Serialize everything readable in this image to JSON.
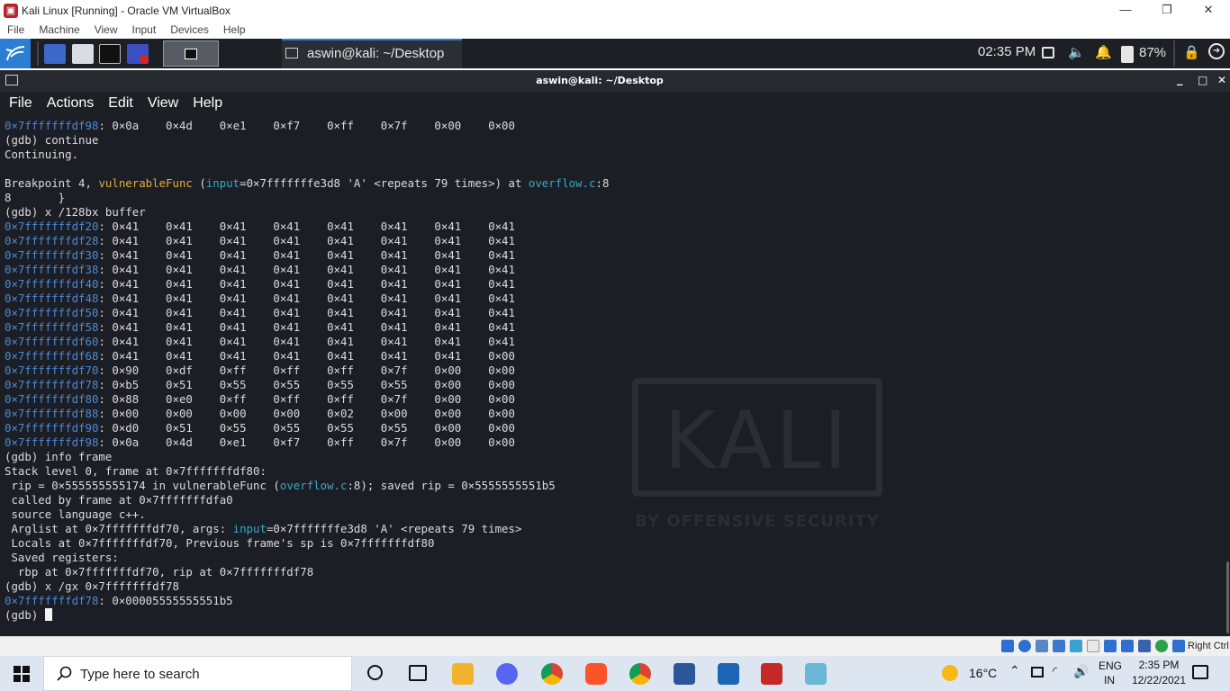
{
  "vbox": {
    "title": "Kali Linux [Running] - Oracle VM VirtualBox",
    "app_icon": "virtualbox-icon",
    "controls": {
      "minimize": "—",
      "restore": "❐",
      "close": "✕"
    },
    "menu": [
      "File",
      "Machine",
      "View",
      "Input",
      "Devices",
      "Help"
    ],
    "status_host_key": "Right Ctrl"
  },
  "panel": {
    "window_title": "aswin@kali: ~/Desktop",
    "clock": "02:35 PM",
    "battery": "87%"
  },
  "terminal": {
    "title": "aswin@kali: ~/Desktop",
    "controls": {
      "minimize": "_",
      "maximize": "□",
      "close": "✕"
    },
    "menu": [
      "File",
      "Actions",
      "Edit",
      "View",
      "Help"
    ],
    "lines": [
      {
        "addr": "0×7fffffffdf98",
        "text": ": 0×0a    0×4d    0×e1    0×f7    0×ff    0×7f    0×00    0×00"
      },
      {
        "text": "(gdb) continue"
      },
      {
        "text": "Continuing."
      },
      {
        "text": ""
      },
      {
        "parts": [
          {
            "t": "Breakpoint 4, "
          },
          {
            "t": "vulnerableFunc",
            "c": "f"
          },
          {
            "t": " ("
          },
          {
            "t": "input",
            "c": "c"
          },
          {
            "t": "=0×7fffffffe3d8 'A' <repeats 79 times>) at "
          },
          {
            "t": "overflow.c",
            "c": "c"
          },
          {
            "t": ":8"
          }
        ]
      },
      {
        "text": "8       }"
      },
      {
        "text": "(gdb) x /128bx buffer"
      },
      {
        "addr": "0×7fffffffdf20",
        "text": ": 0×41    0×41    0×41    0×41    0×41    0×41    0×41    0×41"
      },
      {
        "addr": "0×7fffffffdf28",
        "text": ": 0×41    0×41    0×41    0×41    0×41    0×41    0×41    0×41"
      },
      {
        "addr": "0×7fffffffdf30",
        "text": ": 0×41    0×41    0×41    0×41    0×41    0×41    0×41    0×41"
      },
      {
        "addr": "0×7fffffffdf38",
        "text": ": 0×41    0×41    0×41    0×41    0×41    0×41    0×41    0×41"
      },
      {
        "addr": "0×7fffffffdf40",
        "text": ": 0×41    0×41    0×41    0×41    0×41    0×41    0×41    0×41"
      },
      {
        "addr": "0×7fffffffdf48",
        "text": ": 0×41    0×41    0×41    0×41    0×41    0×41    0×41    0×41"
      },
      {
        "addr": "0×7fffffffdf50",
        "text": ": 0×41    0×41    0×41    0×41    0×41    0×41    0×41    0×41"
      },
      {
        "addr": "0×7fffffffdf58",
        "text": ": 0×41    0×41    0×41    0×41    0×41    0×41    0×41    0×41"
      },
      {
        "addr": "0×7fffffffdf60",
        "text": ": 0×41    0×41    0×41    0×41    0×41    0×41    0×41    0×41"
      },
      {
        "addr": "0×7fffffffdf68",
        "text": ": 0×41    0×41    0×41    0×41    0×41    0×41    0×41    0×00"
      },
      {
        "addr": "0×7fffffffdf70",
        "text": ": 0×90    0×df    0×ff    0×ff    0×ff    0×7f    0×00    0×00"
      },
      {
        "addr": "0×7fffffffdf78",
        "text": ": 0×b5    0×51    0×55    0×55    0×55    0×55    0×00    0×00"
      },
      {
        "addr": "0×7fffffffdf80",
        "text": ": 0×88    0×e0    0×ff    0×ff    0×ff    0×7f    0×00    0×00"
      },
      {
        "addr": "0×7fffffffdf88",
        "text": ": 0×00    0×00    0×00    0×00    0×02    0×00    0×00    0×00"
      },
      {
        "addr": "0×7fffffffdf90",
        "text": ": 0×d0    0×51    0×55    0×55    0×55    0×55    0×00    0×00"
      },
      {
        "addr": "0×7fffffffdf98",
        "text": ": 0×0a    0×4d    0×e1    0×f7    0×ff    0×7f    0×00    0×00"
      },
      {
        "text": "(gdb) info frame"
      },
      {
        "text": "Stack level 0, frame at 0×7fffffffdf80:"
      },
      {
        "parts": [
          {
            "t": " rip = 0×555555555174 in vulnerableFunc ("
          },
          {
            "t": "overflow.c",
            "c": "c"
          },
          {
            "t": ":8); saved rip = 0×5555555551b5"
          }
        ]
      },
      {
        "text": " called by frame at 0×7fffffffdfa0"
      },
      {
        "text": " source language c++."
      },
      {
        "parts": [
          {
            "t": " Arglist at 0×7fffffffdf70, args: "
          },
          {
            "t": "input",
            "c": "c"
          },
          {
            "t": "=0×7fffffffe3d8 'A' <repeats 79 times>"
          }
        ]
      },
      {
        "text": " Locals at 0×7fffffffdf70, Previous frame's sp is 0×7fffffffdf80"
      },
      {
        "text": " Saved registers:"
      },
      {
        "text": "  rbp at 0×7fffffffdf70, rip at 0×7fffffffdf78"
      },
      {
        "text": "(gdb) x /gx 0×7fffffffdf78"
      },
      {
        "addr": "0×7fffffffdf78",
        "text": ": 0×00005555555551b5"
      },
      {
        "prompt": "(gdb) "
      }
    ]
  },
  "watermark": {
    "word": "KALI",
    "tagline": "BY OFFENSIVE SECURITY"
  },
  "taskbar": {
    "search_placeholder": "Type here to search",
    "weather": "16°C",
    "lang_top": "ENG",
    "lang_bottom": "IN",
    "time": "2:35 PM",
    "date": "12/22/2021"
  },
  "colors": {
    "kali_blue": "#2a7fd4",
    "address": "#4f88d4",
    "function": "#e4ad3a",
    "keyword": "#39a9c4",
    "terminal_bg": "#1b1e24"
  }
}
